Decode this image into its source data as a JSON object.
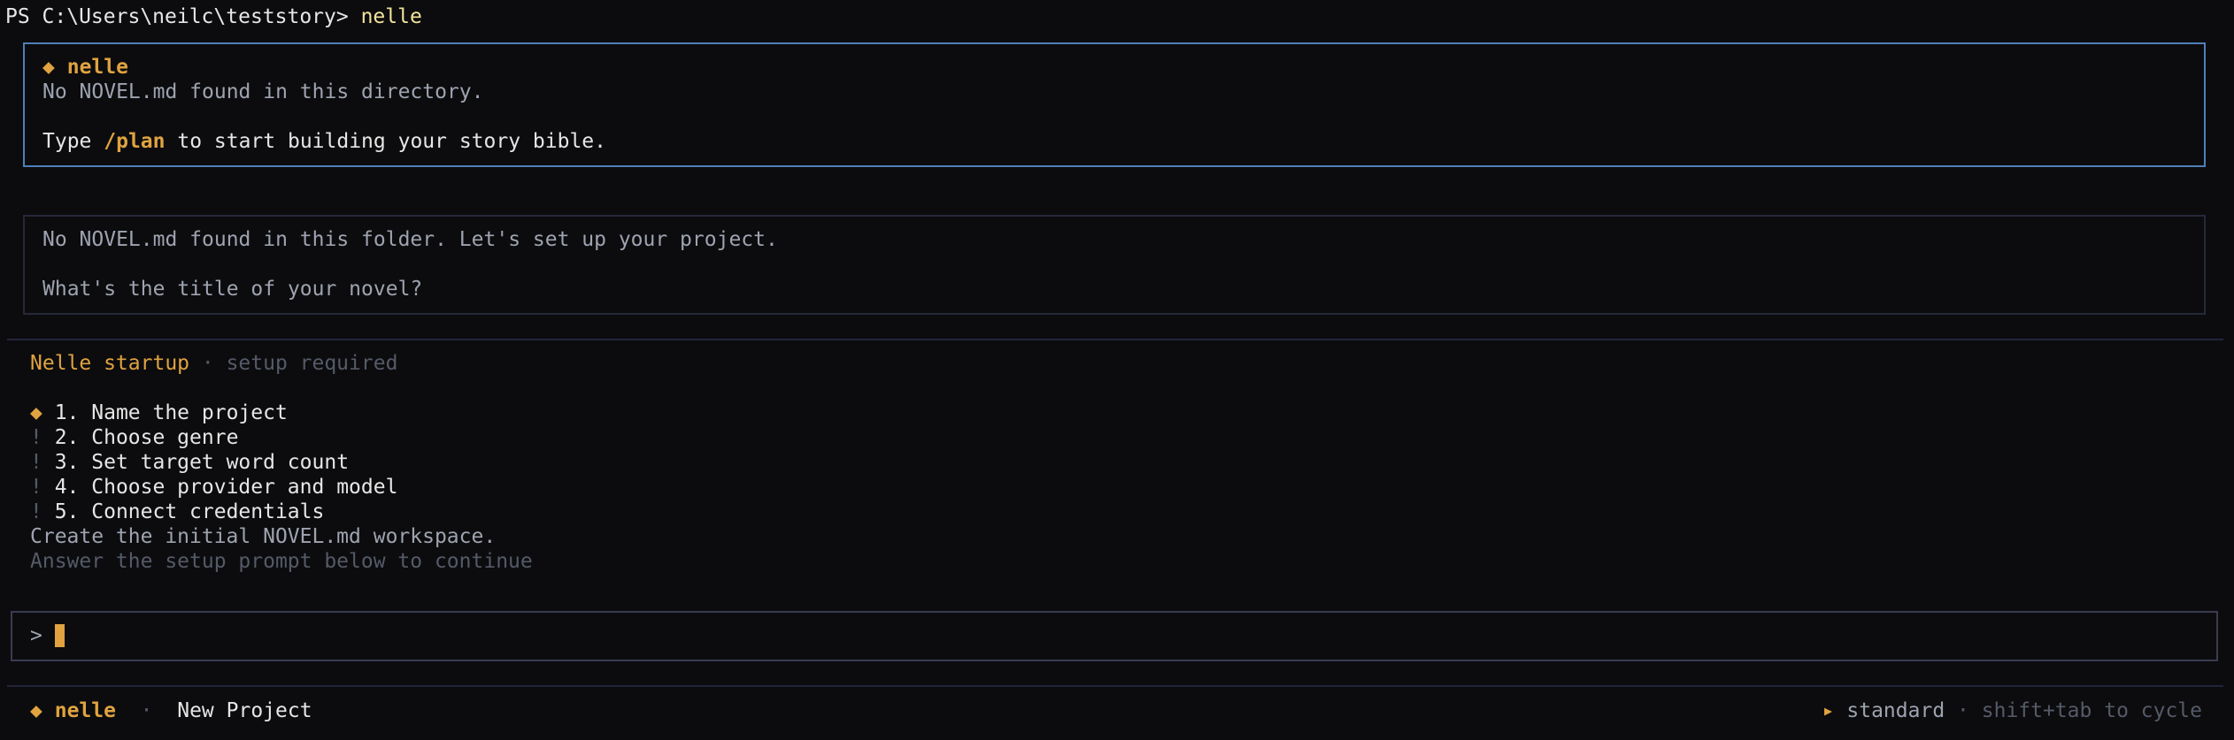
{
  "terminal": {
    "prompt": "PS C:\\Users\\neilc\\teststory> ",
    "command": "nelle"
  },
  "welcome": {
    "bullet": "◆",
    "app_name": "nelle",
    "message": "No NOVEL.md found in this directory.",
    "hint_prefix": "Type ",
    "hint_command": "/plan",
    "hint_suffix": " to start building your story bible."
  },
  "setup_message": {
    "line1": "No NOVEL.md found in this folder. Let's set up your project.",
    "line2": "What's the title of your novel?"
  },
  "startup": {
    "title": "Nelle startup",
    "separator": " · ",
    "status": "setup required",
    "steps": [
      {
        "marker": "◆",
        "label": " 1. Name the project",
        "state": "active"
      },
      {
        "marker": "!",
        "label": " 2. Choose genre",
        "state": "pending"
      },
      {
        "marker": "!",
        "label": " 3. Set target word count",
        "state": "pending"
      },
      {
        "marker": "!",
        "label": " 4. Choose provider and model",
        "state": "pending"
      },
      {
        "marker": "!",
        "label": " 5. Connect credentials",
        "state": "pending"
      }
    ],
    "description": "Create the initial NOVEL.md workspace.",
    "instruction": "Answer the setup prompt below to continue"
  },
  "input": {
    "prompt_symbol": ">",
    "value": ""
  },
  "status_bar": {
    "bullet": "◆",
    "app_name": "nelle",
    "separator": "·",
    "project": "New Project",
    "mode_marker": "▸",
    "mode": "standard",
    "mode_separator": "·",
    "mode_hint": "shift+tab to cycle"
  },
  "colors": {
    "accent": "#e0a340",
    "welcome_border": "#4f7fb8",
    "background": "#0c0c0e",
    "muted_text": "#9ea3b0",
    "dim_text": "#555a68"
  }
}
